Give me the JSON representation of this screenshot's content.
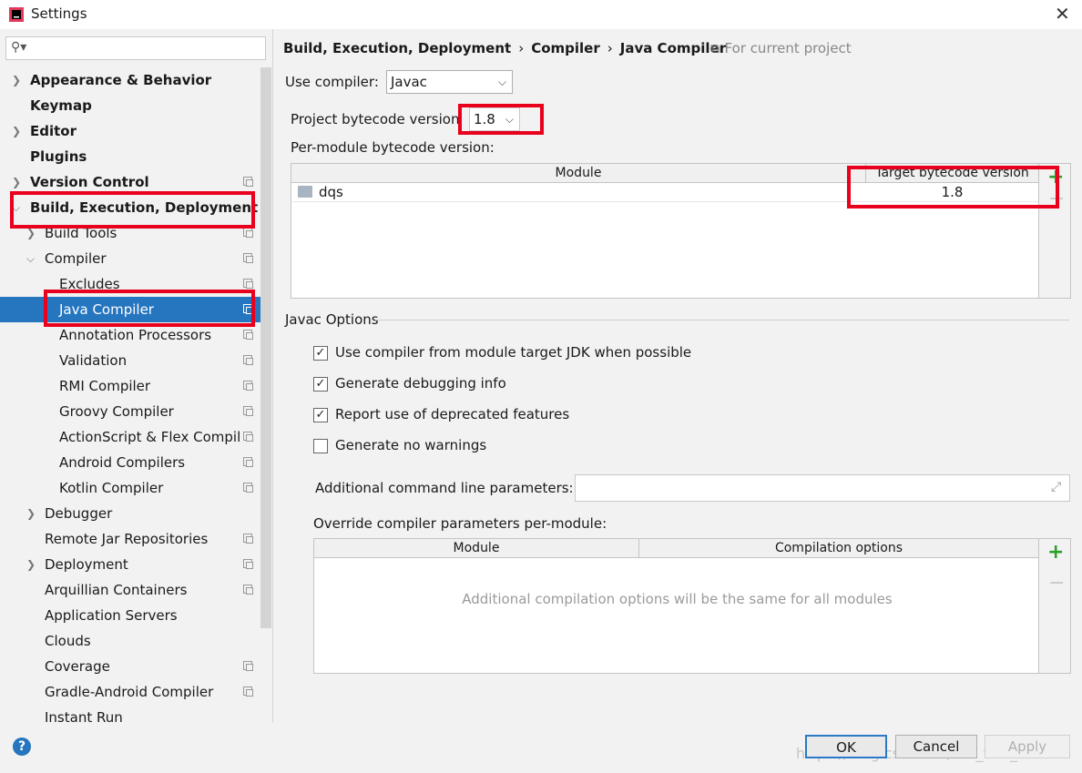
{
  "window": {
    "title": "Settings",
    "close_label": "✕"
  },
  "search": {
    "icon": "search-icon",
    "value": ""
  },
  "sidebar": {
    "items": [
      {
        "label": "Appearance & Behavior",
        "bold": true,
        "arrow": "›"
      },
      {
        "label": "Keymap",
        "bold": true
      },
      {
        "label": "Editor",
        "bold": true,
        "arrow": "›"
      },
      {
        "label": "Plugins",
        "bold": true
      },
      {
        "label": "Version Control",
        "bold": true,
        "arrow": "›",
        "copy": true
      },
      {
        "label": "Build, Execution, Deployment",
        "bold": true,
        "arrow": "⌄"
      },
      {
        "label": "Build Tools",
        "arrow": "›",
        "copy": true
      },
      {
        "label": "Compiler",
        "arrow": "⌄",
        "copy": true
      },
      {
        "label": "Excludes",
        "copy": true
      },
      {
        "label": "Java Compiler",
        "copy": true,
        "selected": true
      },
      {
        "label": "Annotation Processors",
        "copy": true
      },
      {
        "label": "Validation",
        "copy": true
      },
      {
        "label": "RMI Compiler",
        "copy": true
      },
      {
        "label": "Groovy Compiler",
        "copy": true
      },
      {
        "label": "ActionScript & Flex Compil",
        "copy": true
      },
      {
        "label": "Android Compilers",
        "copy": true
      },
      {
        "label": "Kotlin Compiler",
        "copy": true
      },
      {
        "label": "Debugger",
        "arrow": "›"
      },
      {
        "label": "Remote Jar Repositories",
        "copy": true
      },
      {
        "label": "Deployment",
        "arrow": "›",
        "copy": true
      },
      {
        "label": "Arquillian Containers",
        "copy": true
      },
      {
        "label": "Application Servers"
      },
      {
        "label": "Clouds"
      },
      {
        "label": "Coverage",
        "copy": true
      },
      {
        "label": "Gradle-Android Compiler",
        "copy": true
      },
      {
        "label": "Instant Run"
      }
    ]
  },
  "breadcrumb": {
    "part1": "Build, Execution, Deployment",
    "part2": "Compiler",
    "part3": "Java Compiler",
    "sep": "›",
    "scope": "For current project"
  },
  "compiler": {
    "use_label": "Use compiler:",
    "value": "Javac"
  },
  "bytecode": {
    "project_label": "Project bytecode version",
    "project_value": "1.8",
    "per_module_label": "Per-module bytecode version:"
  },
  "module_table": {
    "col_module": "Module",
    "col_target": "Target bytecode version",
    "rows": [
      {
        "module": "dqs",
        "target": "1.8"
      }
    ]
  },
  "javac_options": {
    "title": "Javac Options",
    "checkboxes": [
      {
        "label": "Use compiler from module target JDK when possible",
        "checked": true
      },
      {
        "label": "Generate debugging info",
        "checked": true
      },
      {
        "label": "Report use of deprecated features",
        "checked": true
      },
      {
        "label": "Generate no warnings",
        "checked": false
      }
    ],
    "additional_label": "Additional command line parameters:",
    "additional_value": "",
    "override_label": "Override compiler parameters per-module:",
    "override_col_module": "Module",
    "override_col_options": "Compilation options",
    "override_empty": "Additional compilation options will be the same for all modules"
  },
  "footer": {
    "ok": "OK",
    "cancel": "Cancel",
    "apply": "Apply",
    "help": "?"
  },
  "watermark": "https://blog.csdn.net/the_fool_",
  "colors": {
    "selection": "#2675bf",
    "highlight_box": "#e8001c",
    "add": "#2ca02c"
  }
}
